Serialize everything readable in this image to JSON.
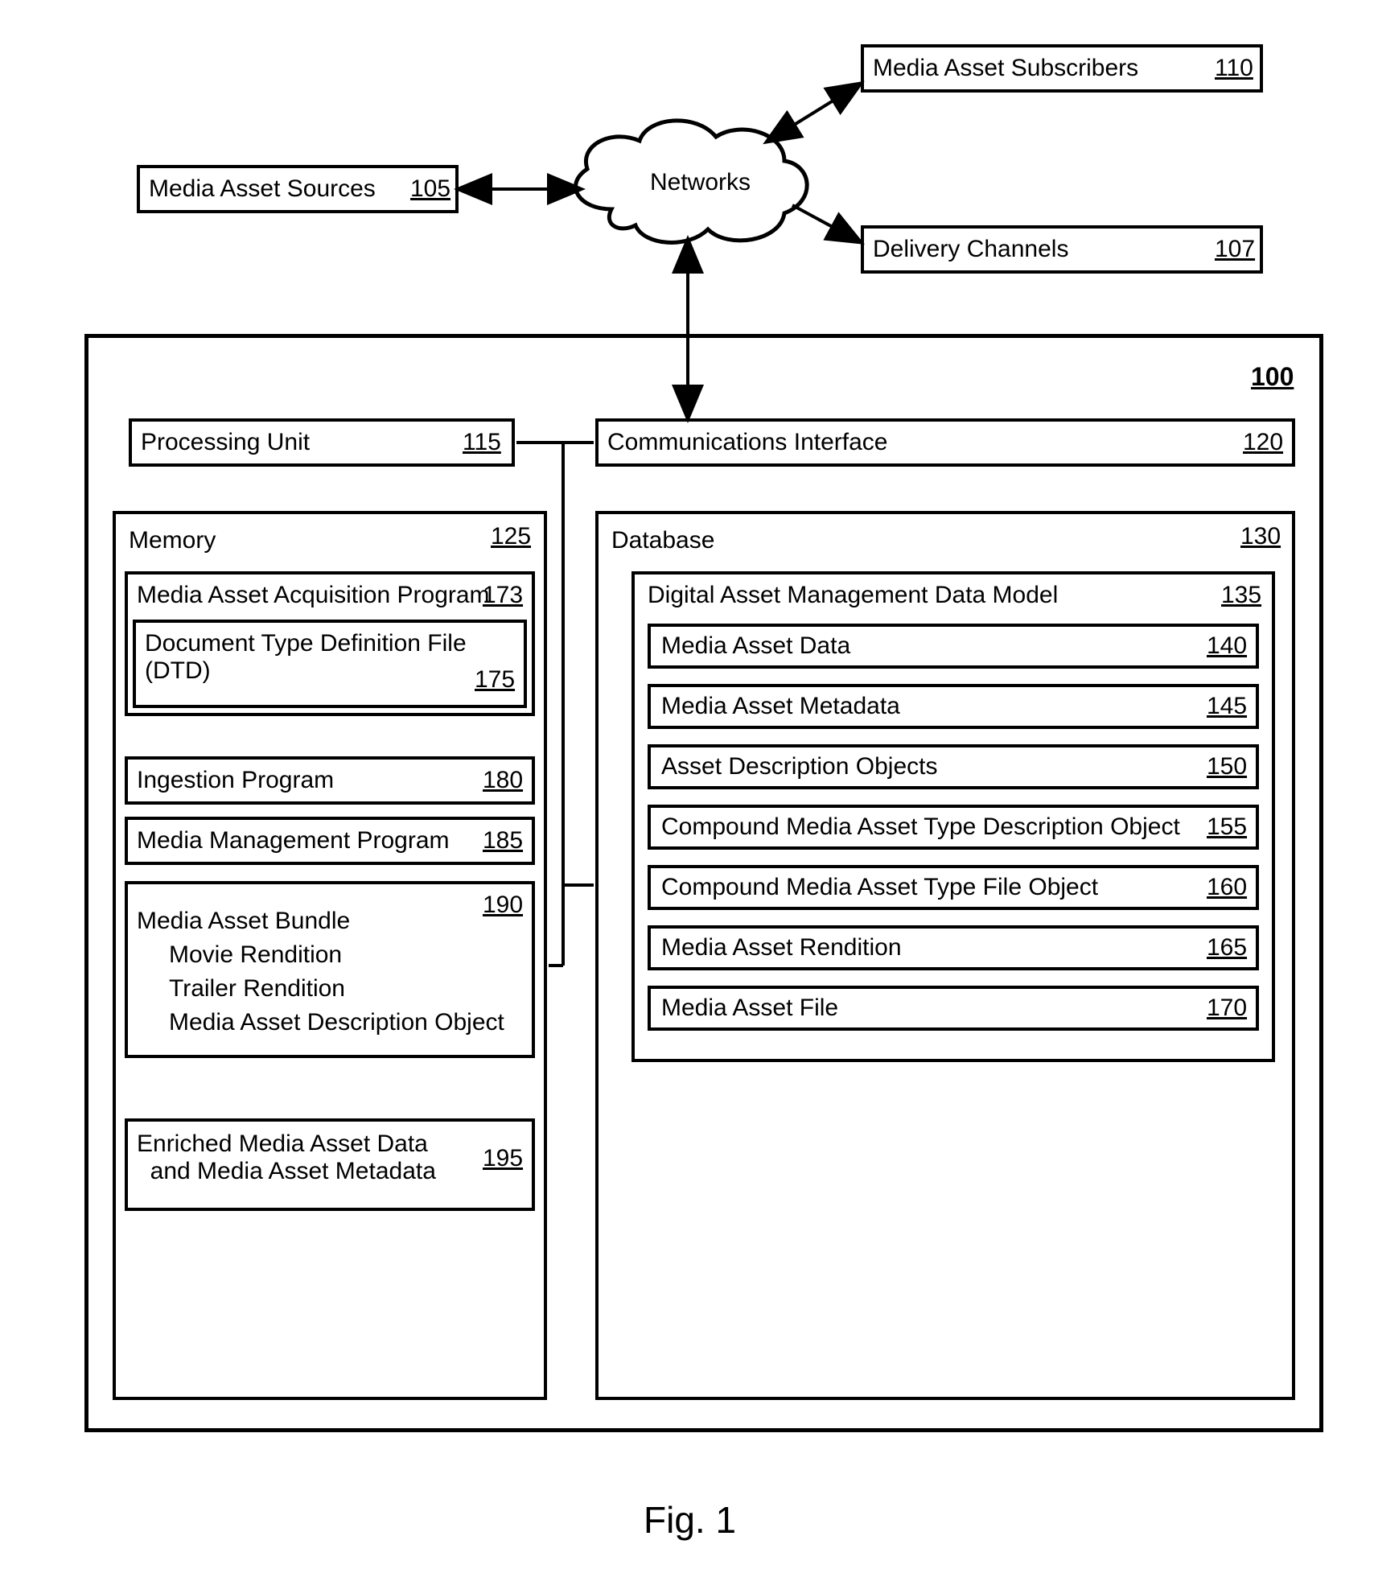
{
  "figure_label": "Fig. 1",
  "cloud": {
    "label": "Networks"
  },
  "top": {
    "sources": {
      "label": "Media Asset Sources",
      "ref": "105"
    },
    "subscribers": {
      "label": "Media Asset Subscribers",
      "ref": "110"
    },
    "channels": {
      "label": "Delivery Channels",
      "ref": "107"
    }
  },
  "system": {
    "ref": "100",
    "processing": {
      "label": "Processing Unit",
      "ref": "115"
    },
    "comms": {
      "label": "Communications Interface",
      "ref": "120"
    },
    "memory": {
      "label": "Memory",
      "ref": "125",
      "acq": {
        "label": "Media Asset Acquisition Program",
        "ref": "173"
      },
      "dtd": {
        "label": "Document Type Definition File\n(DTD)",
        "ref": "175"
      },
      "ing": {
        "label": "Ingestion Program",
        "ref": "180"
      },
      "mgmt": {
        "label": "Media Management Program",
        "ref": "185"
      },
      "bundle": {
        "label": "Media Asset Bundle",
        "ref": "190",
        "l1": "Movie Rendition",
        "l2": "Trailer Rendition",
        "l3": "Media Asset Description Object"
      },
      "enriched": {
        "label": "Enriched Media Asset Data\n  and Media Asset Metadata",
        "ref": "195"
      }
    },
    "database": {
      "label": "Database",
      "ref": "130",
      "model": {
        "label": "Digital Asset Management Data Model",
        "ref": "135",
        "i1": {
          "label": "Media Asset Data",
          "ref": "140"
        },
        "i2": {
          "label": "Media Asset Metadata",
          "ref": "145"
        },
        "i3": {
          "label": "Asset Description Objects",
          "ref": "150"
        },
        "i4": {
          "label": "Compound Media Asset Type Description Object",
          "ref": "155"
        },
        "i5": {
          "label": "Compound Media Asset Type File Object",
          "ref": "160"
        },
        "i6": {
          "label": "Media Asset Rendition",
          "ref": "165"
        },
        "i7": {
          "label": "Media Asset File",
          "ref": "170"
        }
      }
    }
  }
}
